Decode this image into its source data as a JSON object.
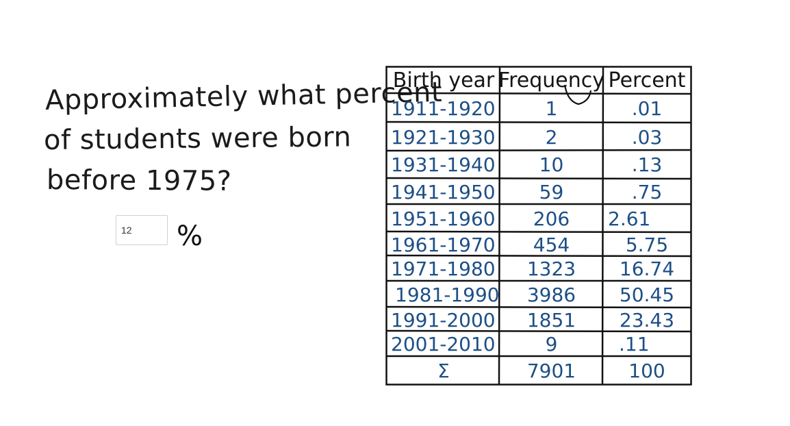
{
  "question": {
    "lines": [
      "Approximately what percent",
      "of students were born",
      "before 1975?"
    ]
  },
  "answer": {
    "value": "12",
    "unit": "%"
  },
  "table": {
    "headers": [
      "Birth year",
      "Frequency",
      "Percent"
    ],
    "rows": [
      [
        "1911-1920",
        "1",
        ".01"
      ],
      [
        "1921-1930",
        "2",
        ".03"
      ],
      [
        "1931-1940",
        "10",
        ".13"
      ],
      [
        "1941-1950",
        "59",
        ".75"
      ],
      [
        "1951-1960",
        "206",
        "2.61"
      ],
      [
        "1961-1970",
        "454",
        "5.75"
      ],
      [
        "1971-1980",
        "1323",
        "16.74"
      ],
      [
        "1981-1990",
        "3986",
        "50.45"
      ],
      [
        "1991-2000",
        "1851",
        "23.43"
      ],
      [
        "2001-2010",
        "9",
        ".11"
      ],
      [
        "Σ",
        "7901",
        "100"
      ]
    ],
    "ink_color": "#1d4f86",
    "line_color": "#111111"
  }
}
